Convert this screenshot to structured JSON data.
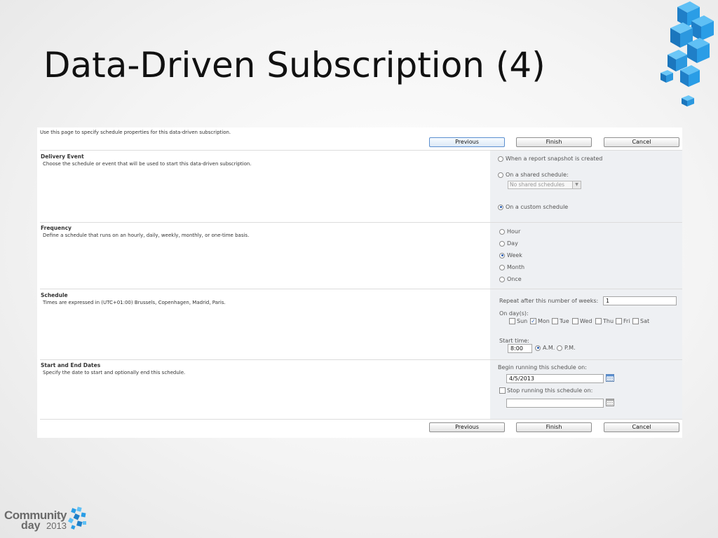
{
  "slide": {
    "title": "Data-Driven Subscription (4)"
  },
  "logo": {
    "line1": "Community",
    "line2": "day",
    "year": "2013"
  },
  "form": {
    "intro": "Use this page to specify schedule properties for this data-driven subscription.",
    "buttons": {
      "previous": "Previous",
      "finish": "Finish",
      "cancel": "Cancel"
    },
    "delivery_event": {
      "title": "Delivery Event",
      "description": "Choose the schedule or event that will be used to start this data-driven subscription.",
      "options": [
        {
          "label": "When a report snapshot is created",
          "selected": false
        },
        {
          "label": "On a shared schedule:",
          "selected": false
        },
        {
          "label": "On a custom schedule",
          "selected": true
        }
      ],
      "shared_schedule_value": "No shared schedules"
    },
    "frequency": {
      "title": "Frequency",
      "description": "Define a schedule that runs on an hourly, daily, weekly, monthly, or one-time basis.",
      "options": [
        {
          "label": "Hour",
          "selected": false
        },
        {
          "label": "Day",
          "selected": false
        },
        {
          "label": "Week",
          "selected": true
        },
        {
          "label": "Month",
          "selected": false
        },
        {
          "label": "Once",
          "selected": false
        }
      ]
    },
    "schedule": {
      "title": "Schedule",
      "description": "Times are expressed in (UTC+01:00) Brussels, Copenhagen, Madrid, Paris.",
      "repeat_label": "Repeat after this number of weeks:",
      "repeat_value": "1",
      "days_label": "On day(s):",
      "days": [
        {
          "label": "Sun",
          "checked": false
        },
        {
          "label": "Mon",
          "checked": true
        },
        {
          "label": "Tue",
          "checked": false
        },
        {
          "label": "Wed",
          "checked": false
        },
        {
          "label": "Thu",
          "checked": false
        },
        {
          "label": "Fri",
          "checked": false
        },
        {
          "label": "Sat",
          "checked": false
        }
      ],
      "start_time_label": "Start time:",
      "start_time_value": "8:00",
      "am_label": "A.M.",
      "pm_label": "P.M.",
      "am_selected": true
    },
    "dates": {
      "title": "Start and End Dates",
      "description": "Specify the date to start and optionally end this schedule.",
      "begin_label": "Begin running this schedule on:",
      "begin_value": "4/5/2013",
      "stop_label": "Stop running this schedule on:",
      "stop_checked": false,
      "stop_value": ""
    }
  },
  "colors": {
    "accent_blue": "#2b8fd6",
    "radio_selected": "#2b5fb4",
    "panel_right_bg": "#eef0f3"
  }
}
